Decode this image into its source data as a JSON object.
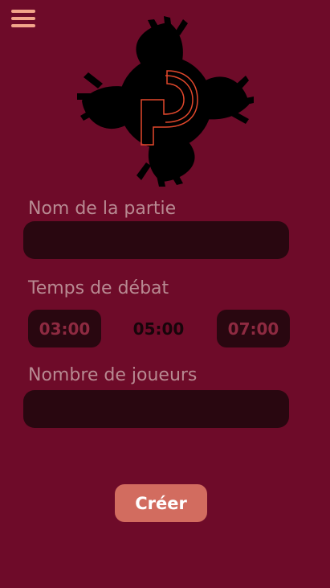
{
  "icons": {
    "menu": "hamburger-menu-icon",
    "logo": "swirling-hands-logo"
  },
  "form": {
    "game_name": {
      "label": "Nom de la partie",
      "value": "",
      "placeholder": ""
    },
    "debate_time": {
      "label": "Temps de débat",
      "options": [
        "03:00",
        "05:00",
        "07:00"
      ],
      "selected": "05:00"
    },
    "player_count": {
      "label": "Nombre de joueurs",
      "value": "",
      "placeholder": ""
    }
  },
  "actions": {
    "create_label": "Créer"
  },
  "colors": {
    "background": "#6e0b29",
    "field": "#290710",
    "accent": "#d26c5f",
    "menu": "#f3a58a",
    "logo_ring": "#e2482c"
  }
}
